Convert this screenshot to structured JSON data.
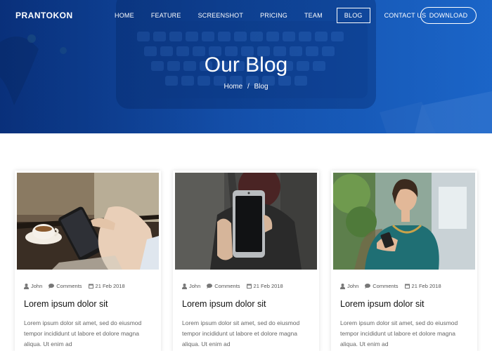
{
  "brand": {
    "name": "PRANTOKON"
  },
  "nav": {
    "items": [
      {
        "label": "HOME"
      },
      {
        "label": "FEATURE"
      },
      {
        "label": "SCREENSHOT"
      },
      {
        "label": "PRICING"
      },
      {
        "label": "TEAM"
      },
      {
        "label": "BLOG",
        "active": true
      },
      {
        "label": "CONTACT US"
      }
    ],
    "download_label": "DOWNLOAD"
  },
  "hero": {
    "title": "Our Blog",
    "breadcrumb": {
      "home": "Home",
      "separator": "/",
      "current": "Blog"
    }
  },
  "posts": [
    {
      "author": "John",
      "comments": "Comments",
      "date": "21 Feb 2018",
      "title": "Lorem ipsum dolor sit",
      "excerpt": "Lorem ipsum dolor sit amet, sed do eiusmod tempor incididunt ut labore et dolore magna aliqua. Ut enim ad"
    },
    {
      "author": "John",
      "comments": "Comments",
      "date": "21 Feb 2018",
      "title": "Lorem ipsum dolor sit",
      "excerpt": "Lorem ipsum dolor sit amet, sed do eiusmod tempor incididunt ut labore et dolore magna aliqua. Ut enim ad"
    },
    {
      "author": "John",
      "comments": "Comments",
      "date": "21 Feb 2018",
      "title": "Lorem ipsum dolor sit",
      "excerpt": "Lorem ipsum dolor sit amet, sed do eiusmod tempor incididunt ut labore et dolore magna aliqua. Ut enim ad"
    }
  ],
  "icons": {
    "author": "user-icon",
    "comments": "comment-icon",
    "date": "calendar-icon"
  },
  "colors": {
    "hero_blue": "#1552ad",
    "text_dark": "#111111",
    "text_muted": "#666666"
  }
}
